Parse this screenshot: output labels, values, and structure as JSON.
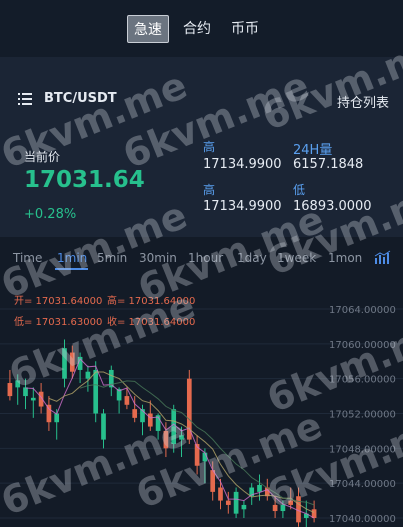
{
  "top_tabs": [
    {
      "label": "急速",
      "active": true
    },
    {
      "label": "合约",
      "active": false
    },
    {
      "label": "币币",
      "active": false
    }
  ],
  "pair": {
    "symbol": "BTC/USDT",
    "holdings_label": "持仓列表"
  },
  "ticker": {
    "current_label": "当前价",
    "price": "17031.64",
    "change": "+0.28%",
    "high_label": "高",
    "high_value": "17134.9900",
    "volume_label": "24H量",
    "volume_value": "6157.1848",
    "high2_label": "高",
    "high2_value": "17134.9900",
    "low_label": "低",
    "low_value": "16893.0000"
  },
  "intervals": [
    {
      "label": "Time",
      "active": false
    },
    {
      "label": "1min",
      "active": true
    },
    {
      "label": "5min",
      "active": false
    },
    {
      "label": "30min",
      "active": false
    },
    {
      "label": "1hour",
      "active": false
    },
    {
      "label": "1day",
      "active": false
    },
    {
      "label": "1week",
      "active": false
    },
    {
      "label": "1mon",
      "active": false
    }
  ],
  "ohlc_info": {
    "open": "开= 17031.64000",
    "high": "高= 17031.64000",
    "low": "低= 17031.63000",
    "close": "收= 17031.64000"
  },
  "watermark": "6kvm.me",
  "colors": {
    "up": "#27c08d",
    "down": "#e56a4e",
    "accent": "#4d8ce6"
  },
  "chart_data": {
    "type": "candlestick",
    "ylim": [
      17040,
      17064
    ],
    "y_ticks": [
      "17064.00000",
      "17060.00000",
      "17056.00000",
      "17052.00000",
      "17048.00000",
      "17044.00000",
      "17040.00000"
    ],
    "y_tick_values": [
      17064,
      17060,
      17056,
      17052,
      17048,
      17044,
      17040
    ],
    "candles": [
      {
        "o": 17055.5,
        "h": 17057.0,
        "l": 17053.5,
        "c": 17054.0
      },
      {
        "o": 17055.0,
        "h": 17056.5,
        "l": 17053.0,
        "c": 17055.8
      },
      {
        "o": 17054.0,
        "h": 17056.0,
        "l": 17052.5,
        "c": 17055.0
      },
      {
        "o": 17053.5,
        "h": 17055.0,
        "l": 17051.5,
        "c": 17053.8
      },
      {
        "o": 17054.5,
        "h": 17055.5,
        "l": 17052.0,
        "c": 17052.8
      },
      {
        "o": 17053.0,
        "h": 17054.0,
        "l": 17050.0,
        "c": 17051.0
      },
      {
        "o": 17051.0,
        "h": 17052.5,
        "l": 17049.0,
        "c": 17052.0
      },
      {
        "o": 17056.0,
        "h": 17060.5,
        "l": 17055.0,
        "c": 17059.5
      },
      {
        "o": 17059.0,
        "h": 17059.8,
        "l": 17056.0,
        "c": 17056.8
      },
      {
        "o": 17057.0,
        "h": 17059.0,
        "l": 17055.5,
        "c": 17058.5
      },
      {
        "o": 17056.0,
        "h": 17057.5,
        "l": 17054.5,
        "c": 17056.8
      },
      {
        "o": 17052.0,
        "h": 17058.0,
        "l": 17051.0,
        "c": 17057.0
      },
      {
        "o": 17049.0,
        "h": 17052.5,
        "l": 17048.0,
        "c": 17052.0
      },
      {
        "o": 17055.0,
        "h": 17057.5,
        "l": 17054.0,
        "c": 17057.0
      },
      {
        "o": 17053.5,
        "h": 17055.0,
        "l": 17052.0,
        "c": 17054.8
      },
      {
        "o": 17054.0,
        "h": 17055.0,
        "l": 17052.5,
        "c": 17053.0
      },
      {
        "o": 17052.5,
        "h": 17054.0,
        "l": 17051.0,
        "c": 17051.5
      },
      {
        "o": 17051.0,
        "h": 17053.0,
        "l": 17049.5,
        "c": 17052.5
      },
      {
        "o": 17052.0,
        "h": 17053.5,
        "l": 17050.0,
        "c": 17050.5
      },
      {
        "o": 17050.0,
        "h": 17052.0,
        "l": 17049.0,
        "c": 17051.8
      },
      {
        "o": 17050.0,
        "h": 17051.0,
        "l": 17047.0,
        "c": 17048.0
      },
      {
        "o": 17048.5,
        "h": 17053.0,
        "l": 17047.5,
        "c": 17052.5
      },
      {
        "o": 17049.0,
        "h": 17050.5,
        "l": 17047.0,
        "c": 17049.5
      },
      {
        "o": 17056.0,
        "h": 17057.0,
        "l": 17048.5,
        "c": 17049.0
      },
      {
        "o": 17048.5,
        "h": 17049.5,
        "l": 17045.0,
        "c": 17046.0
      },
      {
        "o": 17046.5,
        "h": 17048.0,
        "l": 17044.0,
        "c": 17047.5
      },
      {
        "o": 17045.5,
        "h": 17046.5,
        "l": 17042.0,
        "c": 17043.0
      },
      {
        "o": 17043.5,
        "h": 17044.5,
        "l": 17041.0,
        "c": 17042.0
      },
      {
        "o": 17042.0,
        "h": 17043.0,
        "l": 17040.5,
        "c": 17041.5
      },
      {
        "o": 17040.5,
        "h": 17043.5,
        "l": 17040.0,
        "c": 17043.0
      },
      {
        "o": 17041.0,
        "h": 17042.0,
        "l": 17040.0,
        "c": 17041.5
      },
      {
        "o": 17042.5,
        "h": 17044.0,
        "l": 17041.5,
        "c": 17043.5
      },
      {
        "o": 17043.0,
        "h": 17045.0,
        "l": 17042.0,
        "c": 17043.8
      },
      {
        "o": 17043.5,
        "h": 17044.5,
        "l": 17042.0,
        "c": 17042.5
      },
      {
        "o": 17041.5,
        "h": 17042.5,
        "l": 17040.0,
        "c": 17040.8
      },
      {
        "o": 17040.8,
        "h": 17042.0,
        "l": 17040.0,
        "c": 17041.5
      },
      {
        "o": 17042.0,
        "h": 17043.5,
        "l": 17041.0,
        "c": 17041.5
      },
      {
        "o": 17042.5,
        "h": 17043.5,
        "l": 17039.0,
        "c": 17039.5
      },
      {
        "o": 17040.0,
        "h": 17042.0,
        "l": 17038.5,
        "c": 17040.5
      },
      {
        "o": 17041.0,
        "h": 17042.0,
        "l": 17039.5,
        "c": 17040.0
      }
    ]
  }
}
